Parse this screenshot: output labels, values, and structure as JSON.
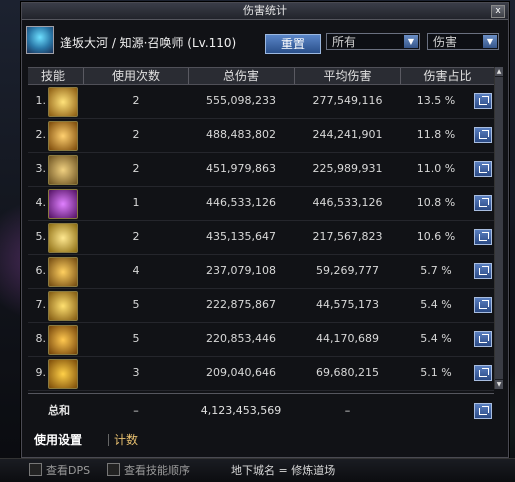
{
  "window": {
    "title": "伤害统计",
    "close": "x"
  },
  "player": {
    "name": "逢坂大河 / 知源·召唤师 (Lv.110)"
  },
  "controls": {
    "reset": "重置",
    "filter": "所有",
    "metric": "伤害"
  },
  "table": {
    "headers": [
      "技能",
      "使用次数",
      "总伤害",
      "平均伤害",
      "伤害占比"
    ],
    "rows": [
      {
        "idx": "1.",
        "uses": "2",
        "total": "555,098,233",
        "avg": "277,549,116",
        "pct": "13.5 %",
        "color": "#e0b040"
      },
      {
        "idx": "2.",
        "uses": "2",
        "total": "488,483,802",
        "avg": "244,241,901",
        "pct": "11.8 %",
        "color": "#d89a30"
      },
      {
        "idx": "3.",
        "uses": "2",
        "total": "451,979,863",
        "avg": "225,989,931",
        "pct": "11.0 %",
        "color": "#c8a050"
      },
      {
        "idx": "4.",
        "uses": "1",
        "total": "446,533,126",
        "avg": "446,533,126",
        "pct": "10.8 %",
        "color": "#b040c0"
      },
      {
        "idx": "5.",
        "uses": "2",
        "total": "435,135,647",
        "avg": "217,567,823",
        "pct": "10.6 %",
        "color": "#e0b838"
      },
      {
        "idx": "6.",
        "uses": "4",
        "total": "237,079,108",
        "avg": "59,269,777",
        "pct": "5.7 %",
        "color": "#d8a030"
      },
      {
        "idx": "7.",
        "uses": "5",
        "total": "222,875,867",
        "avg": "44,575,173",
        "pct": "5.4 %",
        "color": "#e0b040"
      },
      {
        "idx": "8.",
        "uses": "5",
        "total": "220,853,446",
        "avg": "44,170,689",
        "pct": "5.4 %",
        "color": "#d09830"
      },
      {
        "idx": "9.",
        "uses": "3",
        "total": "209,040,646",
        "avg": "69,680,215",
        "pct": "5.1 %",
        "color": "#e0a828"
      }
    ]
  },
  "total": {
    "label": "总和",
    "uses": "–",
    "total": "4,123,453,569",
    "avg": "–"
  },
  "tabs": [
    "使用设置",
    "计数"
  ],
  "footer": {
    "show_dps": "查看DPS",
    "show_order": "查看技能顺序",
    "dungeon": "地下城名 = 修炼道场"
  }
}
